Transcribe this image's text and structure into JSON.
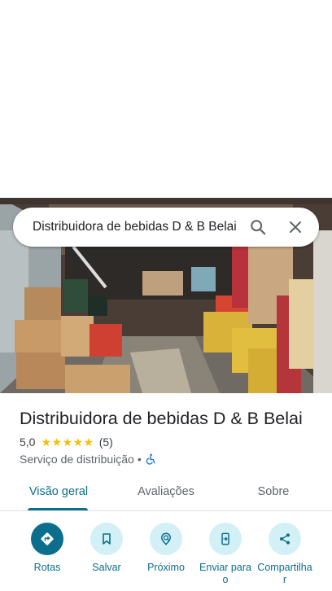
{
  "search": {
    "query": "Distribuidora de bebidas D & B Belai",
    "search_icon": "search-icon",
    "close_icon": "close-icon"
  },
  "place": {
    "name": "Distribuidora de bebidas D & B Belai",
    "rating": "5,0",
    "stars": "★★★★★",
    "review_count": "(5)",
    "category": "Serviço de distribuição",
    "separator": "•",
    "accessibility_icon": "wheelchair-icon"
  },
  "tabs": [
    {
      "label": "Visão geral",
      "active": true
    },
    {
      "label": "Avaliações",
      "active": false
    },
    {
      "label": "Sobre",
      "active": false
    }
  ],
  "actions": [
    {
      "label": "Rotas",
      "icon": "directions-icon"
    },
    {
      "label": "Salvar",
      "icon": "bookmark-icon"
    },
    {
      "label": "Próximo",
      "icon": "nearby-icon"
    },
    {
      "label": "Enviar para o",
      "icon": "send-to-phone-icon"
    },
    {
      "label": "Compartilhar",
      "icon": "share-icon"
    }
  ],
  "colors": {
    "accent": "#0b6e8c",
    "accent_light": "#d3f0f7",
    "star": "#fbbc04"
  }
}
